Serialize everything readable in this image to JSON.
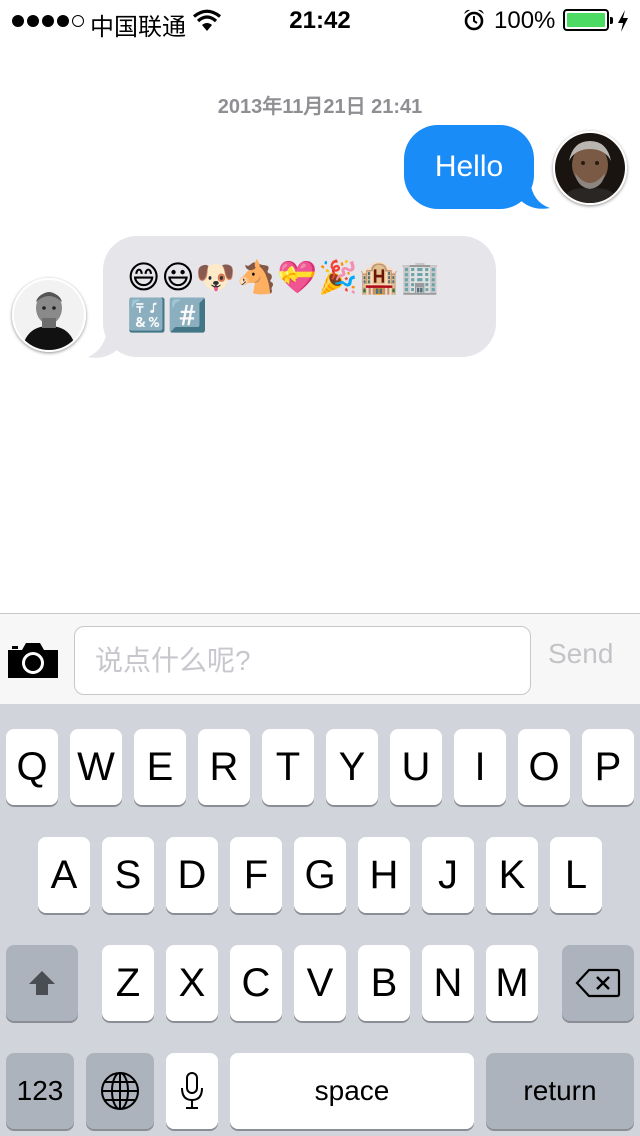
{
  "status_bar": {
    "carrier": "中国联通",
    "time": "21:42",
    "battery_percent": "100%",
    "signal_bars_filled": 4,
    "signal_bars_total": 5,
    "icons": [
      "wifi-icon",
      "alarm-icon",
      "battery-icon",
      "charging-icon"
    ]
  },
  "conversation": {
    "timestamp": "2013年11月21日 21:41",
    "messages": [
      {
        "direction": "outgoing",
        "text": "Hello",
        "avatar": "steve-wozniak-avatar"
      },
      {
        "direction": "incoming",
        "text_lines": [
          "😄😃🐶🐴💝🎉🏨🏢",
          "🔣#️⃣"
        ],
        "avatar": "steve-jobs-avatar"
      }
    ]
  },
  "input_bar": {
    "placeholder": "说点什么呢?",
    "send_label": "Send",
    "camera_icon": "camera-icon"
  },
  "keyboard": {
    "row1": [
      "Q",
      "W",
      "E",
      "R",
      "T",
      "Y",
      "U",
      "I",
      "O",
      "P"
    ],
    "row2": [
      "A",
      "S",
      "D",
      "F",
      "G",
      "H",
      "J",
      "K",
      "L"
    ],
    "row3": [
      "Z",
      "X",
      "C",
      "V",
      "B",
      "N",
      "M"
    ],
    "numbers_label": "123",
    "space_label": "space",
    "return_label": "return",
    "icons": [
      "shift-icon",
      "backspace-icon",
      "globe-icon",
      "microphone-icon"
    ]
  },
  "colors": {
    "outgoing_bubble": "#1a8cf8",
    "incoming_bubble": "#e5e5ea",
    "battery_fill": "#4cd964",
    "timestamp": "#8e8e93",
    "keyboard_bg": "#d1d5db"
  }
}
